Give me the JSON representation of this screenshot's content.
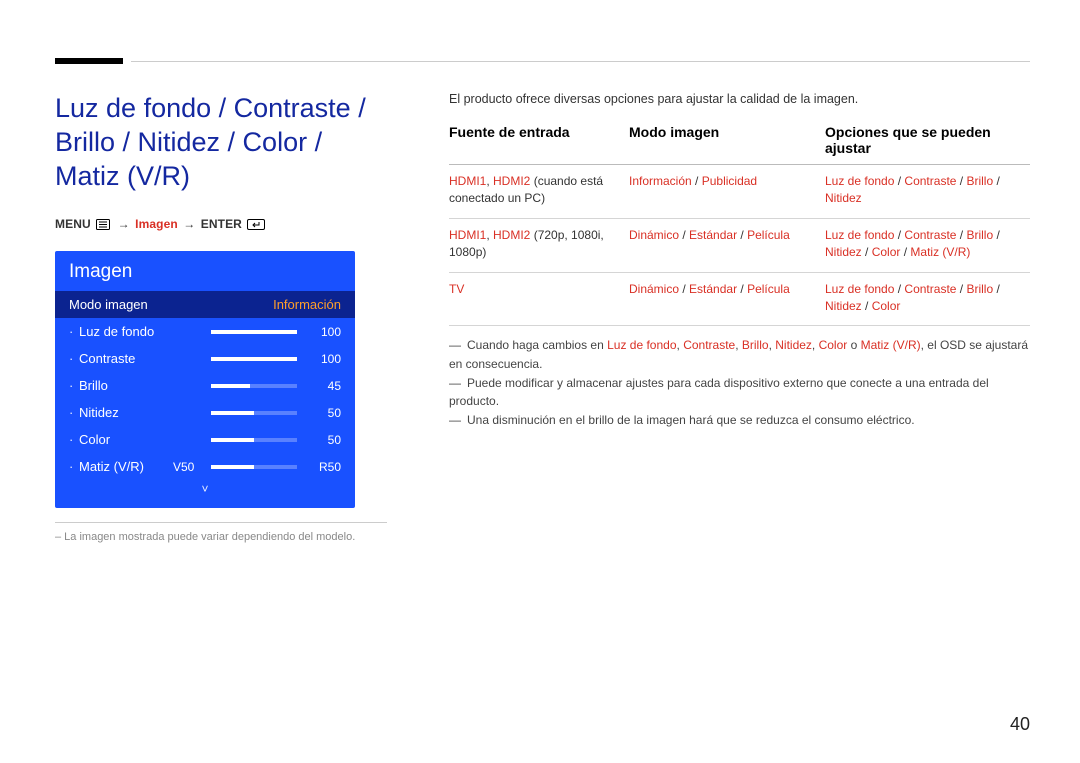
{
  "page": {
    "number": "40",
    "heading": "Luz de fondo / Contraste / Brillo / Nitidez / Color / Matiz (V/R)",
    "breadcrumb": {
      "menu": "MENU",
      "path1": "Imagen",
      "enter": "ENTER"
    },
    "caption": "– La imagen mostrada puede variar dependiendo del modelo."
  },
  "osd": {
    "title": "Imagen",
    "selected_label": "Modo imagen",
    "selected_value": "Información",
    "rows": [
      {
        "label": "Luz de fondo",
        "value": "100",
        "fill": 100
      },
      {
        "label": "Contraste",
        "value": "100",
        "fill": 100
      },
      {
        "label": "Brillo",
        "value": "45",
        "fill": 45
      },
      {
        "label": "Nitidez",
        "value": "50",
        "fill": 50
      },
      {
        "label": "Color",
        "value": "50",
        "fill": 50
      }
    ],
    "tint": {
      "label": "Matiz (V/R)",
      "left": "V50",
      "right": "R50",
      "fill": 50
    }
  },
  "right": {
    "intro": "El producto ofrece diversas opciones para ajustar la calidad de la imagen.",
    "headers": {
      "c1": "Fuente de entrada",
      "c2": "Modo imagen",
      "c3": "Opciones que se pueden ajustar"
    },
    "rows": [
      {
        "c1a": "HDMI1",
        "c1sep1": ", ",
        "c1b": "HDMI2",
        "c1c": " (cuando está conectado un PC)",
        "c2a": "Información",
        "c2sep": " / ",
        "c2b": "Publicidad",
        "c3": [
          "Luz de fondo",
          "Contraste",
          "Brillo",
          "Nitidez"
        ]
      },
      {
        "c1a": "HDMI1",
        "c1sep1": ", ",
        "c1b": "HDMI2",
        "c1c": " (720p, 1080i, 1080p)",
        "c2a": "Dinámico",
        "c2sep": " / ",
        "c2b": "Estándar",
        "c2sep2": " / ",
        "c2c": "Película",
        "c3": [
          "Luz de fondo",
          "Contraste",
          "Brillo",
          "Nitidez",
          "Color",
          "Matiz (V/R)"
        ]
      },
      {
        "c1a": "TV",
        "c1sep1": "",
        "c1b": "",
        "c1c": "",
        "c2a": "Dinámico",
        "c2sep": " / ",
        "c2b": "Estándar",
        "c2sep2": " / ",
        "c2c": "Película",
        "c3": [
          "Luz de fondo",
          "Contraste",
          "Brillo",
          "Nitidez",
          "Color"
        ]
      }
    ],
    "note1_pre": "Cuando haga cambios en ",
    "note1_terms": [
      "Luz de fondo",
      "Contraste",
      "Brillo",
      "Nitidez",
      "Color",
      "Matiz (V/R)"
    ],
    "note1_post": ", el OSD se ajustará en consecuencia.",
    "note2": "Puede modificar y almacenar ajustes para cada dispositivo externo que conecte a una entrada del producto.",
    "note3": "Una disminución en el brillo de la imagen hará que se reduzca el consumo eléctrico."
  }
}
